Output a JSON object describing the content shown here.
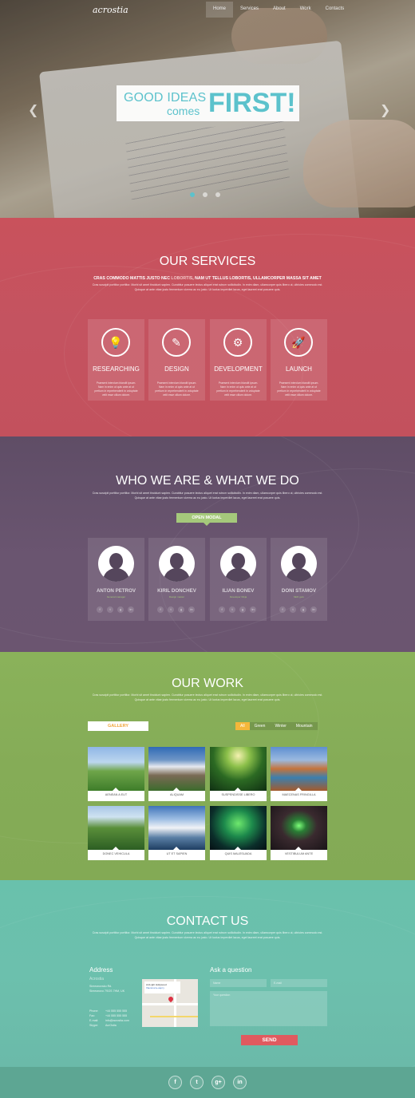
{
  "nav": {
    "logo": "acrostia",
    "items": [
      "Home",
      "Services",
      "About",
      "Work",
      "Contacts"
    ]
  },
  "hero": {
    "line1": "GOOD IDEAS",
    "line2": "comes",
    "line3": "FIRST!",
    "prev_icon": "chevron-left-icon",
    "next_icon": "chevron-right-icon",
    "slide_count": 3,
    "active_slide": 1
  },
  "services": {
    "title": "OUR SERVICES",
    "lead_a": "CRAS COMMODO MATTIS JUSTO NEC ",
    "lead_hl": "LOBORTIS",
    "lead_b": ", NAM UT TELLUS LOBORTIS, ULLAMCORPER MASSA SIT AMET",
    "text": "Cras suscipit porttitor porttitor. Morbi sit amet tincidunt sapien. Curabitur posuere lectus aliquet erat rutrum sollicitudin. In enim diam, ullamcorper quis libero ut, ultricies commodo est. Quisque at ante vitae justo fermentum viverra ac eu justo. Ut luctus imperdiet lacus, eget laoreet erat posuere quis.",
    "items": [
      {
        "name": "RESEARCHING",
        "icon": "lightbulb-icon",
        "glyph": "💡",
        "desc": "Praesent interdum blandit ipsum. Nam in enim ut quis ante at ut pretium in reprehenderit in voluptate velit esse cillum dolore."
      },
      {
        "name": "DESIGN",
        "icon": "magic-wand-icon",
        "glyph": "✎",
        "desc": "Praesent interdum blandit ipsum. Nam in enim ut quis ante at ut pretium in reprehenderit in voluptate velit esse cillum dolore."
      },
      {
        "name": "DEVELOPMENT",
        "icon": "gears-icon",
        "glyph": "⚙",
        "desc": "Praesent interdum blandit ipsum. Nam in enim ut quis ante at ut pretium in reprehenderit in voluptate velit esse cillum dolore."
      },
      {
        "name": "LAUNCH",
        "icon": "rocket-icon",
        "glyph": "🚀",
        "desc": "Praesent interdum blandit ipsum. Nam in enim ut quis ante at ut pretium in reprehenderit in voluptate velit esse cillum dolore."
      }
    ]
  },
  "team": {
    "title": "WHO WE ARE & WHAT WE DO",
    "text": "Cras suscipit porttitor porttitor. Morbi sit amet tincidunt sapien. Curabitur posuere lectus aliquet erat rutrum sollicitudin. In enim diam, ullamcorper quis libero ut, ultricies commodo est. Quisque at ante vitae justo fermentum viverra ac eu justo. Ut luctus imperdiet lacus, eget laoreet erat posuere quis.",
    "modal_label": "OPEN MODAL",
    "members": [
      {
        "name": "ANTON PETROV",
        "role": "General manager"
      },
      {
        "name": "KIRIL DONCHEV",
        "role": "Design master"
      },
      {
        "name": "ILIAN BONEV",
        "role": "Developer Ninja"
      },
      {
        "name": "DONI STAMOV",
        "role": "SEO guru"
      }
    ],
    "social": [
      "f",
      "t",
      "g",
      "in"
    ]
  },
  "work": {
    "title": "OUR WORK",
    "text": "Cras suscipit porttitor porttitor. Morbi sit amet tincidunt sapien. Curabitur posuere lectus aliquet erat rutrum sollicitudin. In enim diam, ullamcorper quis libero ut, ultricies commodo est. Quisque at ante vitae justo fermentum viverra ac eu justo. Ut luctus imperdiet lacus, eget laoreet erat posuere quis.",
    "gallery_label": "GALLERY",
    "filters": [
      "All",
      "Green",
      "Winter",
      "Mountain"
    ],
    "active_filter": "All",
    "tiles": [
      "AENEAN A EUT",
      "ALIQUAM",
      "SUSPENDISSE LIBERO",
      "MAECENAS FRINGILLA",
      "DONEC VEHICULA",
      "UT ET SAPIEN",
      "QUIS MALESUADA",
      "VESTIBULUM ANTE"
    ]
  },
  "contact": {
    "title": "CONTACT US",
    "text": "Cras suscipit porttitor porttitor. Morbi sit amet tincidunt sapien. Curabitur posuere lectus aliquet erat rutrum sollicitudin. In enim diam, ullamcorper quis libero ut, ultricies commodo est. Quisque at ante vitae justo fermentum viverra ac eu justo. Ut luctus imperdiet lacus, eget laoreet erat posuere quis.",
    "address_heading": "Address",
    "company": "Acrostia",
    "street": "Simeonovsko Rd.",
    "city": "Simeonovo 7SGS 7HM, UK",
    "phone_label": "Phone:",
    "phone": "+44 555 555 555",
    "fax_label": "Fax:",
    "fax": "+44 555 555 555",
    "email_label": "E-mail:",
    "email": "info@acrostia.com",
    "skype_label": "Skype:",
    "skype": "AcrOstia",
    "map_place": "ArcLight Hollywood",
    "map_sub": "Увеличить карту",
    "ask_heading": "Ask a question",
    "name_placeholder": "Name",
    "email_placeholder": "E-mail",
    "message_placeholder": "Your question",
    "send_label": "SEND"
  },
  "footer": {
    "social": [
      "f",
      "t",
      "g+",
      "in"
    ]
  }
}
